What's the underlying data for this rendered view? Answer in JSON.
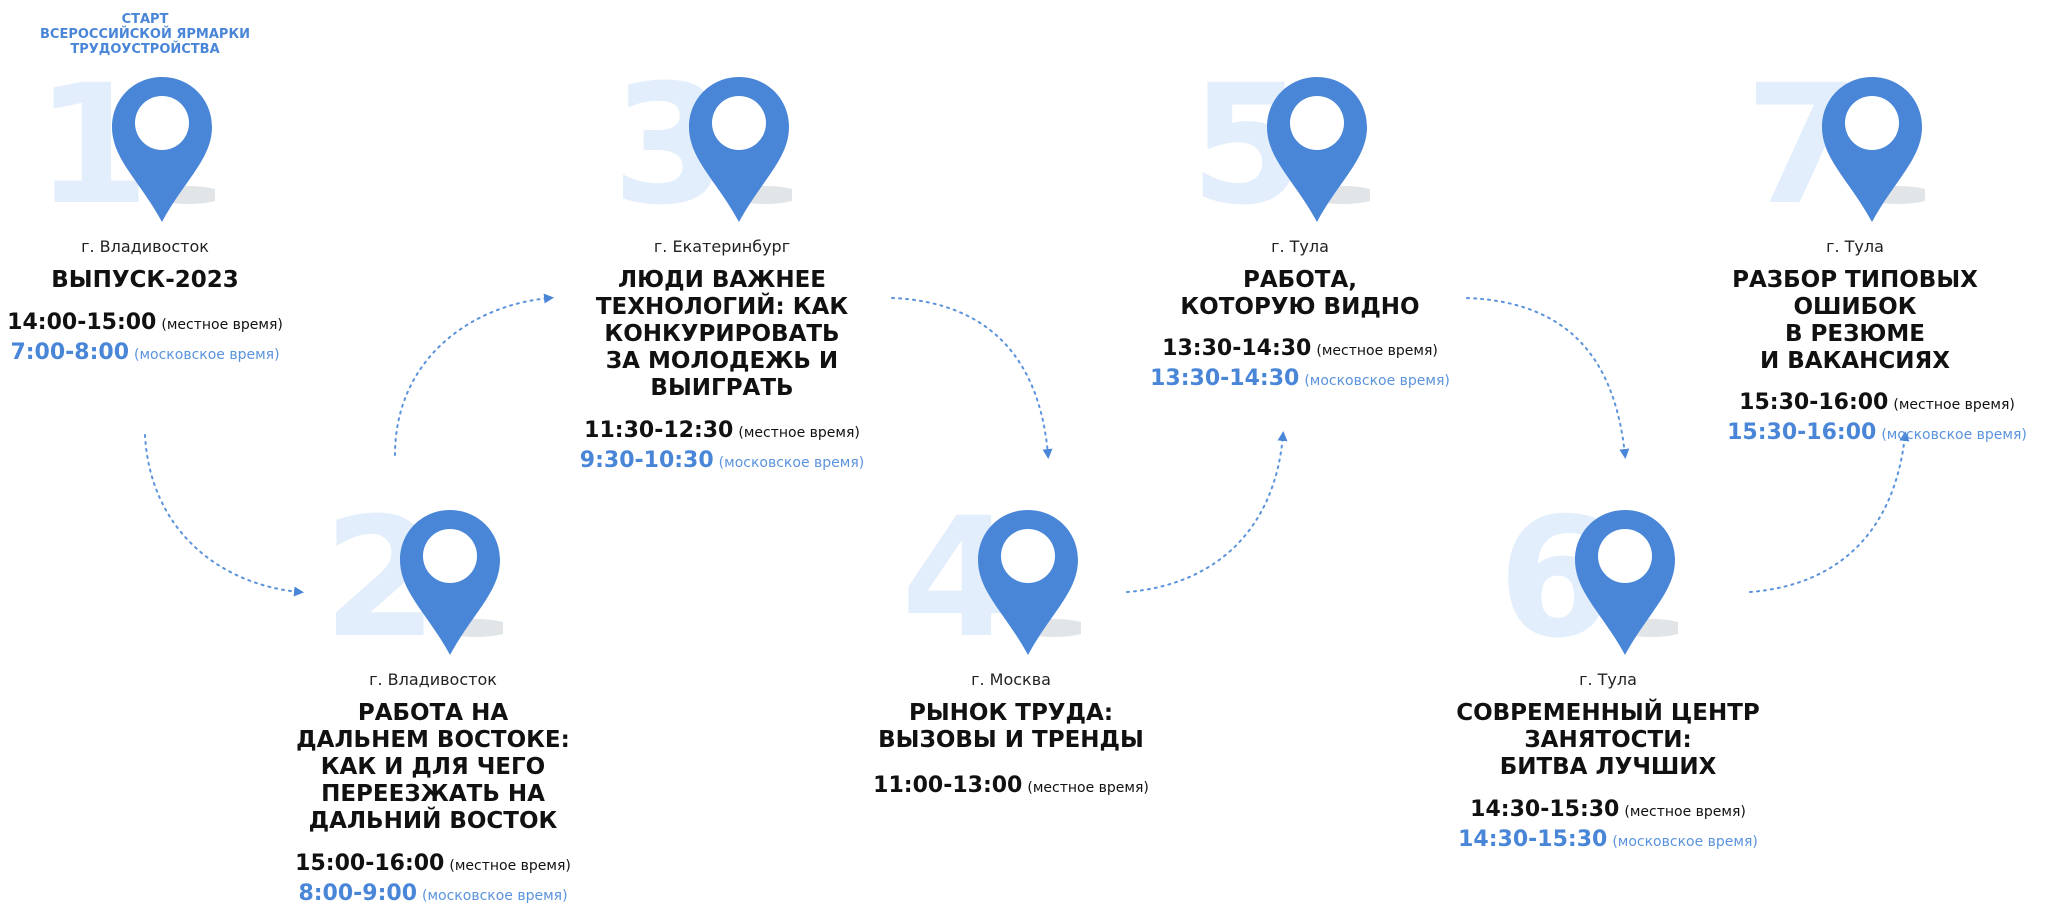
{
  "start_label": "СТАРТ\nВСЕРОССИЙСКОЙ ЯРМАРКИ\nТРУДОУСТРОЙСТВА",
  "colors": {
    "accent": "#4a86d8",
    "number": "#e2eefc",
    "pin_shadow": "#cfd3d8"
  },
  "icons": {
    "pin": "map-pin-icon",
    "connector": "dotted-arrow-icon"
  },
  "stops": [
    {
      "number": "1",
      "city": "г. Владивосток",
      "title": "ВЫПУСК-2023",
      "local_time": "14:00-15:00",
      "local_note": "(местное время)",
      "msk_time": "7:00-8:00",
      "msk_note": "(московское время)"
    },
    {
      "number": "2",
      "city": "г. Владивосток",
      "title": "РАБОТА НА\nДАЛЬНЕМ ВОСТОКЕ:\nКАК И ДЛЯ ЧЕГО\nПЕРЕЕЗЖАТЬ НА\nДАЛЬНИЙ ВОСТОК",
      "local_time": "15:00-16:00",
      "local_note": "(местное время)",
      "msk_time": "8:00-9:00",
      "msk_note": "(московское время)"
    },
    {
      "number": "3",
      "city": "г. Екатеринбург",
      "title": "ЛЮДИ ВАЖНЕЕ\nТЕХНОЛОГИЙ: КАК\nКОНКУРИРОВАТЬ\nЗА МОЛОДЕЖЬ И\nВЫИГРАТЬ",
      "local_time": "11:30-12:30",
      "local_note": "(местное время)",
      "msk_time": "9:30-10:30",
      "msk_note": "(московское время)"
    },
    {
      "number": "4",
      "city": "г. Москва",
      "title": "РЫНОК ТРУДА:\nВЫЗОВЫ И ТРЕНДЫ",
      "local_time": "11:00-13:00",
      "local_note": "(местное время)"
    },
    {
      "number": "5",
      "city": "г. Тула",
      "title": "РАБОТА,\nКОТОРУЮ ВИДНО",
      "local_time": "13:30-14:30",
      "local_note": "(местное время)",
      "msk_time": "13:30-14:30",
      "msk_note": "(московское время)"
    },
    {
      "number": "6",
      "city": "г. Тула",
      "title": "СОВРЕМЕННЫЙ ЦЕНТР\nЗАНЯТОСТИ:\nБИТВА ЛУЧШИХ",
      "local_time": "14:30-15:30",
      "local_note": "(местное время)",
      "msk_time": "14:30-15:30",
      "msk_note": "(московское время)"
    },
    {
      "number": "7",
      "city": "г. Тула",
      "title": "РАЗБОР ТИПОВЫХ\nОШИБОК\nВ РЕЗЮМЕ\nИ ВАКАНСИЯХ",
      "local_time": "15:30-16:00",
      "local_note": "(местное время)",
      "msk_time": "15:30-16:00",
      "msk_note": "(московское время)"
    }
  ]
}
